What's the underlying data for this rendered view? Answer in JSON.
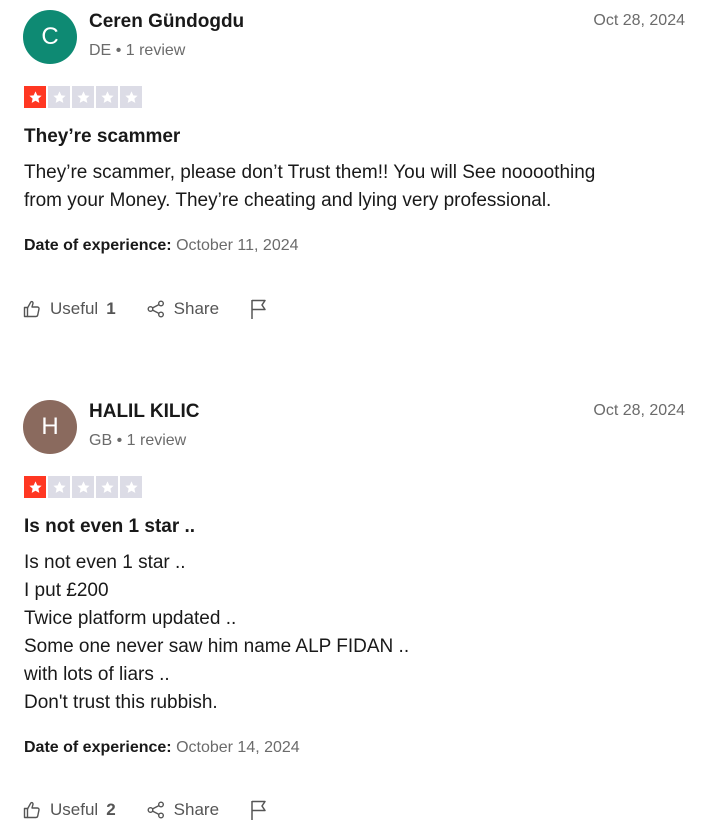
{
  "reviews": [
    {
      "avatar_letter": "C",
      "avatar_color": "#0e8a73",
      "name": "Ceren Gündogdu",
      "country": "DE",
      "separator": "•",
      "review_count": "1 review",
      "date": "Oct 28, 2024",
      "rating": 1,
      "rating_max": 5,
      "title": "They’re scammer",
      "body_lines": [
        "They’re scammer, please don’t Trust them!! You will See noooothing",
        "from your Money. They’re cheating and lying very professional."
      ],
      "experience_label": "Date of experience:",
      "experience_date": "October 11, 2024",
      "useful_label": "Useful",
      "useful_count": "1",
      "share_label": "Share"
    },
    {
      "avatar_letter": "H",
      "avatar_color": "#8a6a5e",
      "name": "HALIL KILIC",
      "country": "GB",
      "separator": "•",
      "review_count": "1 review",
      "date": "Oct 28, 2024",
      "rating": 1,
      "rating_max": 5,
      "title": "Is not even 1 star ..",
      "body_lines": [
        "Is not even 1 star ..",
        "I put £200",
        "Twice platform updated ..",
        "Some one never saw him name ALP FIDAN ..",
        "with lots of liars ..",
        "Don't trust this rubbish."
      ],
      "experience_label": "Date of experience:",
      "experience_date": "October 14, 2024",
      "useful_label": "Useful",
      "useful_count": "2",
      "share_label": "Share"
    }
  ],
  "colors": {
    "star_filled": "#ff3722",
    "star_empty": "#dcdce6",
    "icon_gray": "#555555"
  },
  "icons": {
    "useful": "thumbs-up-icon",
    "share": "share-icon",
    "report": "flag-icon",
    "star": "star-icon"
  }
}
